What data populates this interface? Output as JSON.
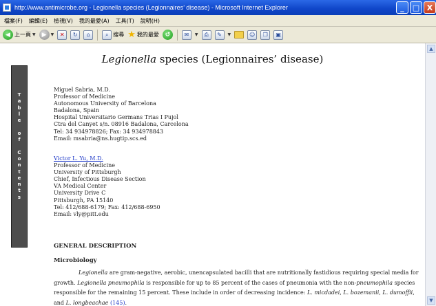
{
  "window": {
    "title": "http://www.antimicrobe.org - Legionella species (Legionnaires’ disease) - Microsoft Internet Explorer",
    "buttons": {
      "minimize": "_",
      "maximize": "□",
      "close": "X"
    }
  },
  "menu": [
    "檔案(F)",
    "編輯(E)",
    "檢視(V)",
    "我的最愛(A)",
    "工具(T)",
    "說明(H)"
  ],
  "toolbar": {
    "back_label": "上一頁",
    "search_label": "搜尋",
    "favorites_label": "我的最愛"
  },
  "sidebar": {
    "toc_letters": [
      "T",
      "a",
      "b",
      "l",
      "e",
      "",
      "o",
      "f",
      "",
      "C",
      "o",
      "n",
      "t",
      "e",
      "n",
      "t",
      "s"
    ]
  },
  "page": {
    "title_italic": "Legionella",
    "title_rest": " species (Legionnaires’ disease)",
    "author1": [
      "Miguel Sabria, M.D.",
      "Professor of Medicine",
      "Autonomous University of Barcelona",
      "Badalona, Spain",
      "Hospital Universitario Germans Trias I Pujol",
      "Ctra del Canyet s/n. 08916 Badalona, Carcelona",
      "Tel: 34 934978826; Fax: 34 934978843",
      "Email: msabria@ns.hugtip.scs.ed"
    ],
    "author2_name": "Victor L. Yu, M.D.",
    "author2": [
      "Professor of Medicine",
      "University of Pittsburgh",
      "Chief, Infectious Disease Section",
      "VA Medical Center",
      "University Drive C",
      "Pittsburgh, PA 15140",
      "Tel: 412/688-6179; Fax: 412/688-6950",
      "Email:  vly@pitt.edu"
    ],
    "section_heading": "GENERAL DESCRIPTION",
    "subsection_heading": "Microbiology",
    "para": {
      "t1": "Legionella",
      "t2": " are gram-negative, aerobic, unencapsulated bacilli that are nutritionally fastidious requiring special media for growth. ",
      "t3": "Legionella pneumophila",
      "t4": " is responsible for up to 85 percent of the cases of pneumonia with the non-",
      "t5": "pneumophila",
      "t6": " species responsible for the remaining 15 percent. These include in order of decreasing incidence: ",
      "t7": "L. micdadei",
      "t8": ", ",
      "t9": "L. bozemanii",
      "t10": ", ",
      "t11": "L. dumoffii",
      "t12": ", and ",
      "t13": "L. longbeachae",
      "t14": " ",
      "ref": "(145)",
      "t15": "."
    }
  }
}
